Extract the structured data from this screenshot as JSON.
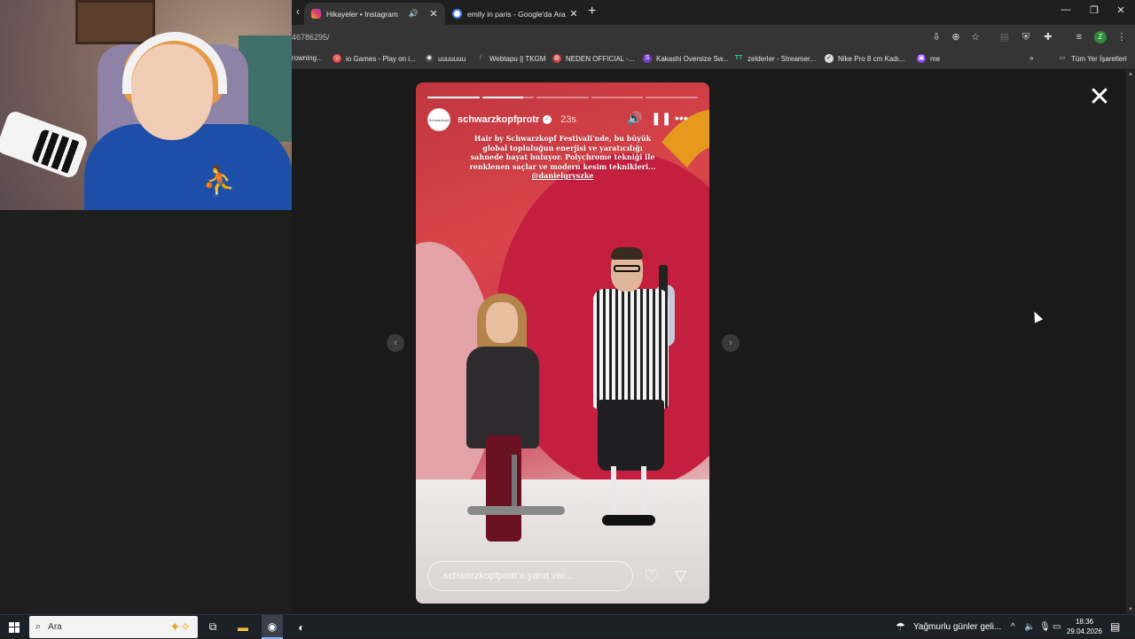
{
  "browser": {
    "tabs": [
      {
        "title": "Hikayeler • Instagram",
        "active": true,
        "audio": true
      },
      {
        "title": "emily in paris - Google'da Ara",
        "active": false,
        "audio": false
      }
    ],
    "url_visible": "46786295/",
    "bookmarks": [
      "rowning...",
      "io Games - Play on i...",
      "uuuuuuu",
      "Webtapu || TKGM",
      "NEDEN OFFICIAL -...",
      "Kakashi Oversize Sw...",
      "zelderler - Streamer...",
      "Nike Pro 8 cm Kadı...",
      "me"
    ],
    "all_bookmarks_label": "Tüm Yer İşaretleri",
    "profile_initial": "Z"
  },
  "story": {
    "username": "schwarzkopfprotr",
    "time_ago": "23s",
    "progress_segments": [
      1,
      0.8,
      0,
      0,
      0
    ],
    "avatar_text": "Schwarzkopf",
    "caption_lines": [
      "Hair by Schwarzkopf Festivali'nde, bu büyük",
      "global topluluğun enerjisi ve yaratıcılığı",
      "sahnede hayat buluyor. Polychrome tekniği ile",
      "renklenen saçlar ve modern kesim teknikleri..."
    ],
    "caption_mention": "@danielgryszke",
    "reply_placeholder": "schwarzkopfprotr'e yanıt ver..."
  },
  "taskbar": {
    "search_label": "Ara",
    "weather_text": "Yağmurlu günler geli...",
    "time": "18:36",
    "date": "29.04.2026"
  },
  "colors": {
    "chrome_dark": "#1f1f1f",
    "chrome_mid": "#353535",
    "page_bg": "#1a1a1a",
    "taskbar": "#1c2027"
  }
}
